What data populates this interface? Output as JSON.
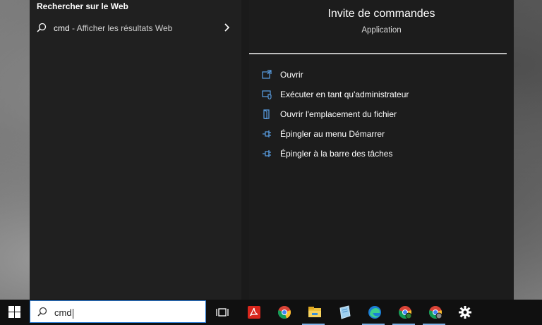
{
  "search_panel": {
    "section_header": "Rechercher sur le Web",
    "web_result_query": "cmd",
    "web_result_suffix": " - Afficher les résultats Web"
  },
  "app_details": {
    "title": "Invite de commandes",
    "subtitle": "Application",
    "actions": [
      {
        "label": "Ouvrir",
        "icon": "open-icon"
      },
      {
        "label": "Exécuter en tant qu'administrateur",
        "icon": "run-as-admin-icon"
      },
      {
        "label": "Ouvrir l'emplacement du fichier",
        "icon": "file-location-icon"
      },
      {
        "label": "Épingler au menu Démarrer",
        "icon": "pin-icon"
      },
      {
        "label": "Épingler à la barre des tâches",
        "icon": "pin-icon"
      }
    ]
  },
  "taskbar": {
    "search_value": "cmd",
    "icons": [
      "windows-start-icon",
      "task-view-icon",
      "acrobat-icon",
      "chrome-icon",
      "file-explorer-icon",
      "notepad-icon",
      "edge-icon",
      "chrome-icon",
      "chrome-icon",
      "settings-icon"
    ]
  },
  "colors": {
    "accent": "#2b7bd4",
    "menu_bg": "#202020",
    "icon_blue": "#5aa0e6"
  }
}
